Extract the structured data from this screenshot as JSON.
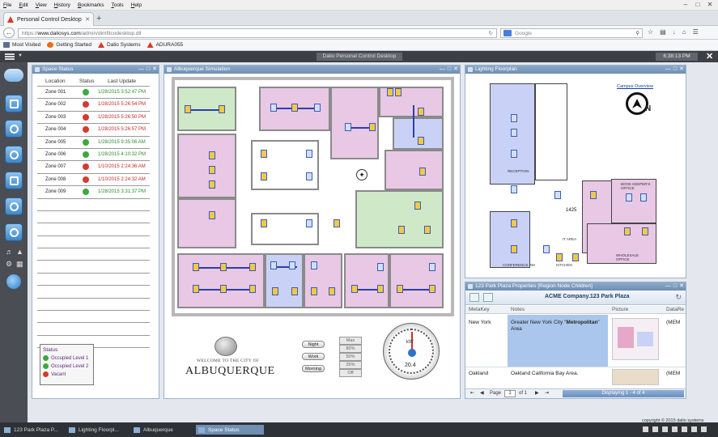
{
  "browser": {
    "menu": [
      "File",
      "Edit",
      "View",
      "History",
      "Bookmarks",
      "Tools",
      "Help"
    ],
    "tab_title": "Personal Control Desktop",
    "url_scheme": "https://",
    "url_host": "www.daliosys.com",
    "url_path": "/admin/dimfitcodesktop.dll",
    "search_placeholder": "Google",
    "bookmarks": [
      "Most Visited",
      "Getting Started",
      "Dalio Systems",
      "ADURA055"
    ]
  },
  "app": {
    "title": "Dalio Personal Control Desktop",
    "clock": "6:38:13 PM"
  },
  "space_status": {
    "title": "Space Status",
    "columns": [
      "Location",
      "Status",
      "Last Update"
    ],
    "rows": [
      {
        "loc": "Zone 001",
        "status": "ok",
        "update": "1/28/2015 3:52:47 PM"
      },
      {
        "loc": "Zone 002",
        "status": "alert",
        "update": "1/28/2015 5:26:54 PM"
      },
      {
        "loc": "Zone 003",
        "status": "alert",
        "update": "1/28/2015 5:26:50 PM"
      },
      {
        "loc": "Zone 004",
        "status": "alert",
        "update": "1/28/2015 5:26:57 PM"
      },
      {
        "loc": "Zone 005",
        "status": "ok",
        "update": "1/28/2015 9:35:06 AM"
      },
      {
        "loc": "Zone 006",
        "status": "ok",
        "update": "1/28/2015 4:10:32 PM"
      },
      {
        "loc": "Zone 007",
        "status": "alert",
        "update": "1/10/2015 2:24:36 AM"
      },
      {
        "loc": "Zone 008",
        "status": "alert",
        "update": "1/10/2015 2:24:32 AM"
      },
      {
        "loc": "Zone 009",
        "status": "ok",
        "update": "1/28/2015 3:31:37 PM"
      }
    ],
    "legend": {
      "title": "Status",
      "items": [
        {
          "label": "Occupied Level 1",
          "color": "#3ea83e"
        },
        {
          "label": "Occupied Level 2",
          "color": "#3ea83e"
        },
        {
          "label": "Vacant",
          "color": "#d23b31"
        }
      ]
    }
  },
  "simulation": {
    "title": "Albuquerque Simulation",
    "city_line1": "WELCOME TO THE CITY OF",
    "city_line2": "ALBUQUERQUE",
    "buttons": [
      "Night",
      "Work",
      "Morning"
    ],
    "levels": [
      "Max",
      "80%",
      "50%",
      "25%",
      "Off"
    ],
    "gauge_unit": "kW",
    "gauge_value": "20.4"
  },
  "lighting": {
    "title": "Lighting Floorplan",
    "campus_link": "Campus Overview",
    "compass_label": "N",
    "labels": {
      "reception": "RECEPTION",
      "conference": "CONFERENCE RM",
      "it": "IT AREA",
      "kitchen": "KITCHEN",
      "bookkeeper": "BOOK KEEPER'S OFFICE",
      "wholesale": "WHOLESALE OFFICE",
      "room": "1425"
    }
  },
  "properties": {
    "title": "123 Park Plaza Properties [Region Node Children]",
    "company": "ACME Company.123 Park Plaza",
    "columns": [
      "MetaKey",
      "Notes",
      "Picture",
      "DataRe"
    ],
    "rows": [
      {
        "key": "New York",
        "notes_pre": "Greater New York City \"",
        "notes_bold": "Metropolitan",
        "notes_post": "\" Area",
        "data": "(MEM"
      },
      {
        "key": "Oakland",
        "notes_pre": "Oakland California Bay Area.",
        "notes_bold": "",
        "notes_post": "",
        "data": "(MEM"
      }
    ],
    "pager_page_label": "Page",
    "pager_page": "1",
    "pager_of": "of 1",
    "pager_display": "Displaying 1 - 4 of 4"
  },
  "taskbar": {
    "items": [
      "123 Park Plaza P...",
      "Lighting Floorpl...",
      "Albuquerque",
      "Space Status"
    ],
    "copyright": "copyright © 2015 dalio systems"
  },
  "colors": {
    "ok": "#3ea83e",
    "alert": "#d23b31",
    "room_purple": "#e8c8e4",
    "room_green": "#cfe9c8",
    "room_blue": "#c9d2f6"
  }
}
